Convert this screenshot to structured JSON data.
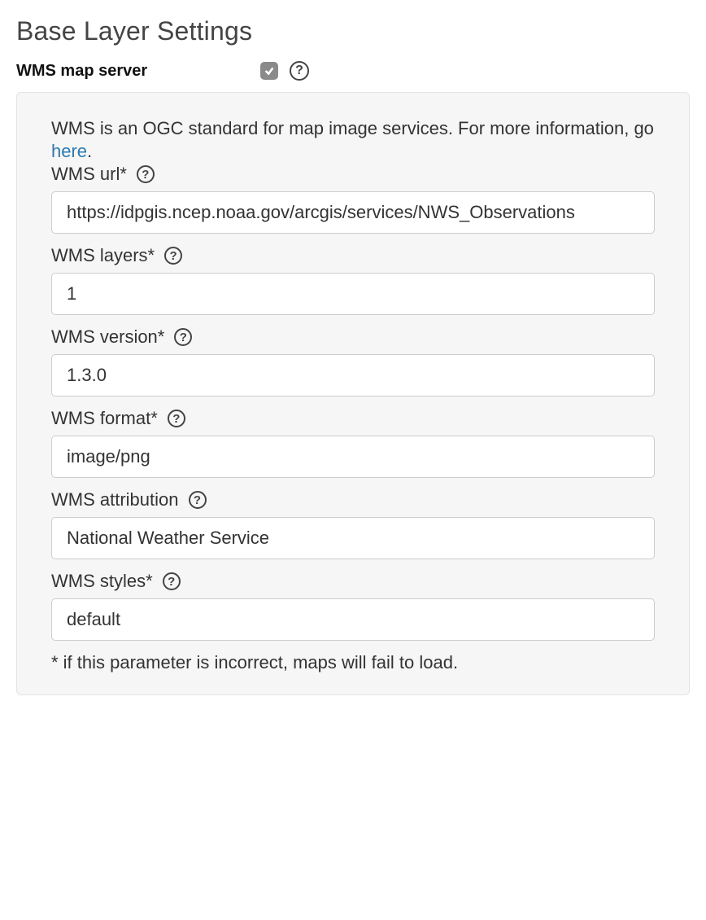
{
  "header": {
    "title": "Base Layer Settings"
  },
  "toggle": {
    "label": "WMS map server",
    "checked": true
  },
  "panel": {
    "description_prefix": "WMS is an OGC standard for map image services. For more information, go ",
    "description_link_text": "here",
    "description_suffix": ".",
    "fields": {
      "url": {
        "label": "WMS url*",
        "value": "https://idpgis.ncep.noaa.gov/arcgis/services/NWS_Observations"
      },
      "layers": {
        "label": "WMS layers*",
        "value": "1"
      },
      "version": {
        "label": "WMS version*",
        "value": "1.3.0"
      },
      "format": {
        "label": "WMS format*",
        "value": "image/png"
      },
      "attribution": {
        "label": "WMS attribution",
        "value": "National Weather Service"
      },
      "styles": {
        "label": "WMS styles*",
        "value": "default"
      }
    },
    "footnote": "* if this parameter is incorrect, maps will fail to load."
  }
}
